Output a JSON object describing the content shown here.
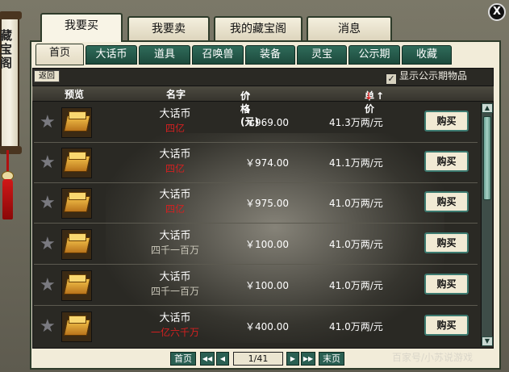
{
  "side_title": "藏宝阁",
  "close_label": "X",
  "main_tabs": [
    {
      "label": "我要买",
      "active": true
    },
    {
      "label": "我要卖",
      "active": false
    },
    {
      "label": "我的藏宝阁",
      "active": false
    },
    {
      "label": "消息",
      "active": false
    }
  ],
  "sub_tabs": [
    {
      "label": "首页",
      "active": true
    },
    {
      "label": "大话币",
      "active": false
    },
    {
      "label": "道具",
      "active": false
    },
    {
      "label": "召唤兽",
      "active": false
    },
    {
      "label": "装备",
      "active": false
    },
    {
      "label": "灵宝",
      "active": false
    },
    {
      "label": "公示期",
      "active": false
    },
    {
      "label": "收藏",
      "active": false
    }
  ],
  "back_label": "返回",
  "show_public_label": "显示公示期物品",
  "show_public_checked": true,
  "columns": {
    "preview": "预览",
    "name": "名字",
    "price": "价格(元)",
    "price_sort": "↑ ↓",
    "unit": "单价",
    "unit_sort_up": "↑",
    "unit_sort_down": "↓"
  },
  "rows": [
    {
      "name": "大话币",
      "amount": "四亿",
      "amount_color": "red",
      "price": "￥969.00",
      "unit": "41.3万两/元",
      "buy": "购买"
    },
    {
      "name": "大话币",
      "amount": "四亿",
      "amount_color": "red",
      "price": "￥974.00",
      "unit": "41.1万两/元",
      "buy": "购买"
    },
    {
      "name": "大话币",
      "amount": "四亿",
      "amount_color": "red",
      "price": "￥975.00",
      "unit": "41.0万两/元",
      "buy": "购买"
    },
    {
      "name": "大话币",
      "amount": "四千一百万",
      "amount_color": "grey",
      "price": "￥100.00",
      "unit": "41.0万两/元",
      "buy": "购买"
    },
    {
      "name": "大话币",
      "amount": "四千一百万",
      "amount_color": "grey",
      "price": "￥100.00",
      "unit": "41.0万两/元",
      "buy": "购买"
    },
    {
      "name": "大话币",
      "amount": "一亿六千万",
      "amount_color": "red",
      "price": "￥400.00",
      "unit": "41.0万两/元",
      "buy": "购买"
    }
  ],
  "pagination": {
    "first": "首页",
    "prev_fast": "◀◀",
    "prev": "◀",
    "page": "1/41",
    "next": "▶",
    "next_fast": "▶▶",
    "last": "末页"
  },
  "credit": "百家号/小苏说游戏"
}
